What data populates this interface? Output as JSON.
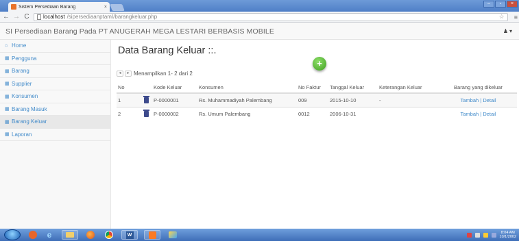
{
  "browser": {
    "tab_title": "Sistem Persediaan Barang",
    "tab_close": "×",
    "url_host": "localhost",
    "url_path": "/sipersediaanptamI/barangkeluar.php",
    "window_controls": [
      "–",
      "▫",
      "×"
    ]
  },
  "navbar": {
    "brand": "SI Persediaan Barang Pada PT ANUGERAH MEGA LESTARI BERBASIS MOBILE",
    "user_icon": "♟",
    "user_caret": "▾"
  },
  "sidebar": {
    "items": [
      {
        "label": "Home",
        "icon": "home-icon"
      },
      {
        "label": "Pengguna",
        "icon": "grid-icon"
      },
      {
        "label": "Barang",
        "icon": "grid-icon"
      },
      {
        "label": "Supplier",
        "icon": "grid-icon"
      },
      {
        "label": "Konsumen",
        "icon": "grid-icon"
      },
      {
        "label": "Barang Masuk",
        "icon": "grid-icon"
      },
      {
        "label": "Barang Keluar",
        "icon": "grid-icon",
        "active": true
      },
      {
        "label": "Laporan",
        "icon": "grid-icon"
      }
    ]
  },
  "main": {
    "title": "Data Barang Keluar ::.",
    "add_button": "+",
    "pager": {
      "prev": "◂",
      "next": "▸",
      "text": "Menampilkan 1- 2 dari 2"
    },
    "table": {
      "headers": [
        "No",
        "",
        "Kode Keluar",
        "Konsumen",
        "No Faktur",
        "Tanggal Keluar",
        "Keterangan Keluar",
        "Barang yang dikeluar"
      ],
      "rows": [
        {
          "no": "1",
          "kode": "P-0000001",
          "konsumen": "Rs. Muhammadiyah Palembang",
          "faktur": "009",
          "tanggal": "2015-10-10",
          "keterangan": "-",
          "tambah": "Tambah",
          "detail": "Detail"
        },
        {
          "no": "2",
          "kode": "P-0000002",
          "konsumen": "Rs. Umum Palembang",
          "faktur": "0012",
          "tanggal": "2006-10-31",
          "keterangan": "",
          "tambah": "Tambah",
          "detail": "Detail"
        }
      ]
    }
  },
  "taskbar": {
    "clock_time": "8:04 AM",
    "clock_date": "10/1/2002"
  },
  "colors": {
    "link": "#428bca",
    "titlebar": "#4f7fc7",
    "add_button": "#3e9d1f"
  }
}
